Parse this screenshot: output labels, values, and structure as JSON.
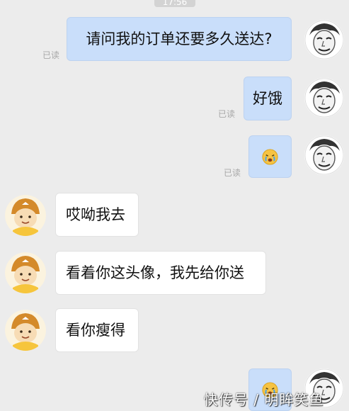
{
  "chat": {
    "timestamp": "17:56",
    "read_label": "已读",
    "messages": [
      {
        "text": "请问我的订单还要多久送达?"
      },
      {
        "text": "好饿"
      },
      {
        "emoji": "crying-face"
      },
      {
        "text": "哎呦我去"
      },
      {
        "text": "看着你这头像，我先给你送"
      },
      {
        "text": "看你瘦得"
      },
      {
        "emoji": "crying-face"
      }
    ]
  },
  "watermark": "快传号 / 明眸笑鱼",
  "colors": {
    "background": "#ececec",
    "outgoing_bubble": "#c9defa",
    "incoming_bubble": "#ffffff",
    "read_receipt": "#a8a8a8",
    "courier_helmet": "#d48a2a"
  }
}
